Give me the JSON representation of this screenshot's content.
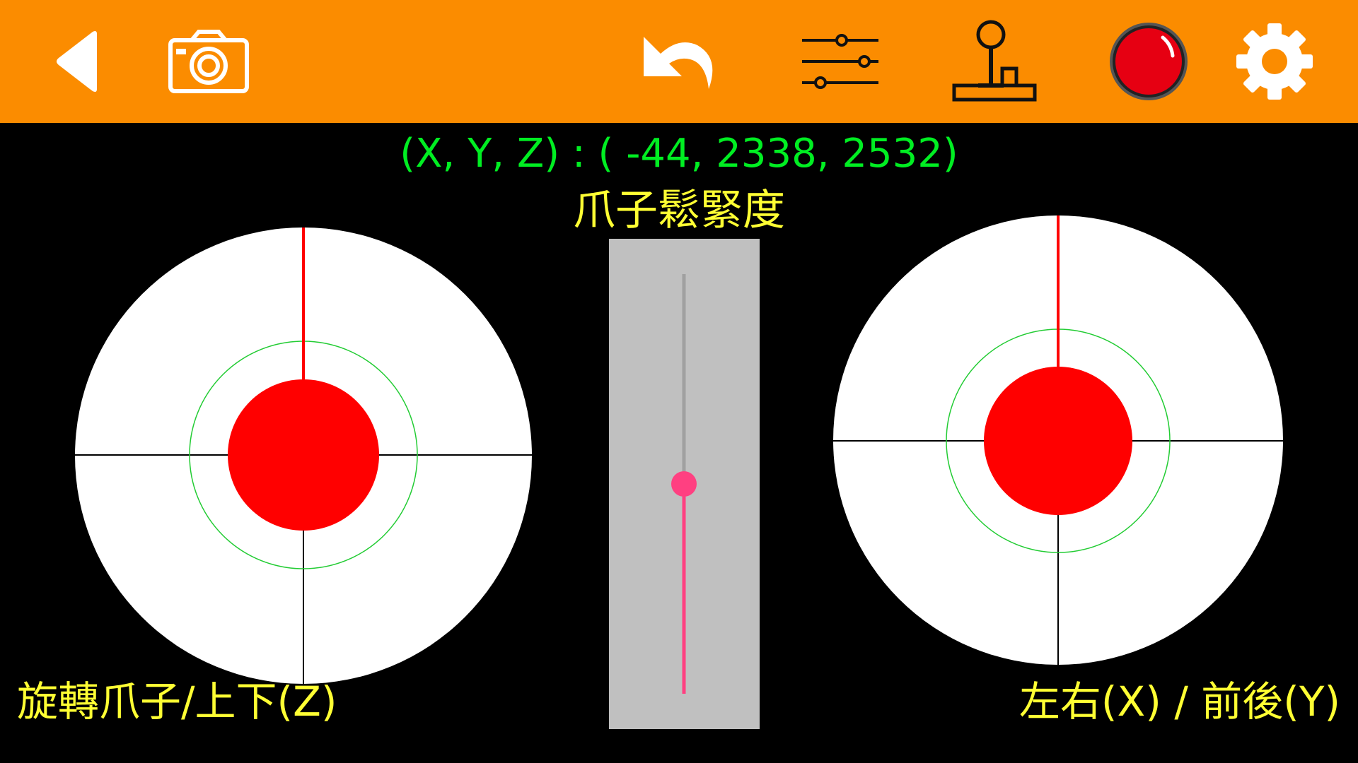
{
  "toolbar": {
    "background": "#FB8C00",
    "buttons": [
      {
        "name": "back",
        "icon": "back-triangle-icon"
      },
      {
        "name": "camera",
        "icon": "camera-icon"
      },
      {
        "name": "undo",
        "icon": "undo-icon"
      },
      {
        "name": "adjust",
        "icon": "sliders-icon"
      },
      {
        "name": "joystick",
        "icon": "joystick-icon"
      },
      {
        "name": "record",
        "icon": "record-button-icon"
      },
      {
        "name": "settings",
        "icon": "gear-icon"
      }
    ]
  },
  "coords": {
    "text": "(X, Y, Z) : ( -44, 2338, 2532)",
    "color": "#00EE22"
  },
  "gripper": {
    "title": "爪子鬆緊度",
    "value_fraction": 0.5,
    "track_color": "#FF4081"
  },
  "left_joystick": {
    "label": "旋轉爪子/上下(Z)"
  },
  "right_joystick": {
    "label": "左右(X) / 前後(Y)"
  },
  "colors": {
    "label": "#FFFF33",
    "knob": "#FF0000",
    "pad": "#FFFFFF",
    "ring": "#22CC33"
  }
}
